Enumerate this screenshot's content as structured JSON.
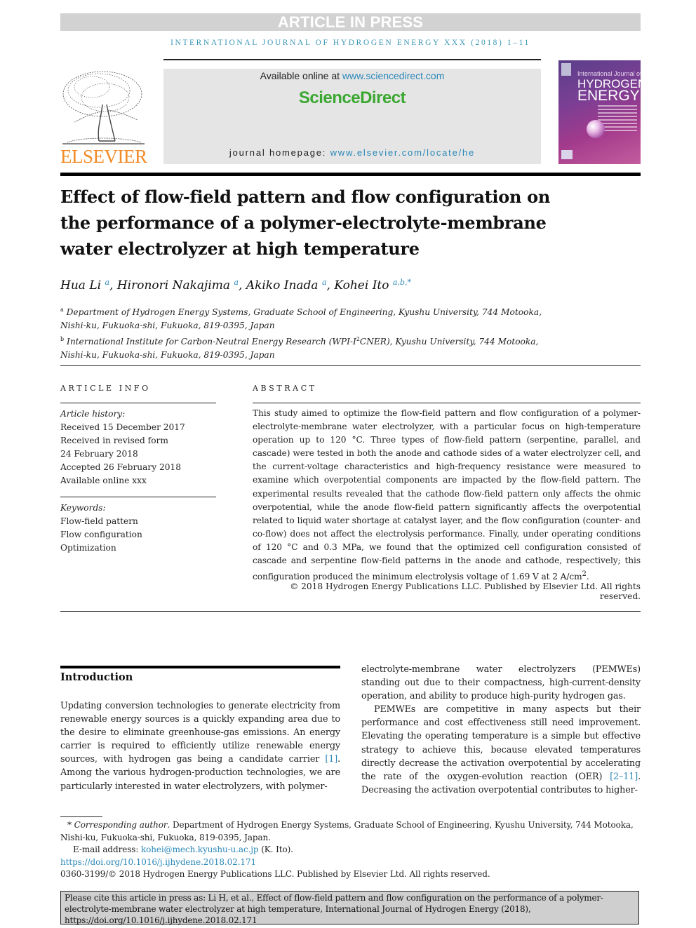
{
  "banner": {
    "article_in_press": "ARTICLE IN PRESS"
  },
  "journal_line": "INTERNATIONAL JOURNAL OF HYDROGEN ENERGY XXX (2018) 1–11",
  "header": {
    "publisher_logo_text": "ELSEVIER",
    "available_online_prefix": "Available online at ",
    "available_online_link": "www.sciencedirect.com",
    "sciencedirect_title": "ScienceDirect",
    "homepage_prefix": "journal homepage: ",
    "homepage_link": "www.elsevier.com/locate/he",
    "cover": {
      "subtitle": "International Journal of",
      "title_line1": "HYDROGEN",
      "title_line2": "ENERGY"
    },
    "colors": {
      "elsevier_orange": "#f28c28",
      "sciencedirect_green": "#3aa830",
      "link_blue": "#2a88b8",
      "cover_purple": "#7a3f94"
    }
  },
  "article": {
    "title": "Effect of flow-field pattern and flow configuration on the performance of a polymer-electrolyte-membrane water electrolyzer at high temperature",
    "authors": [
      {
        "name": "Hua Li",
        "sup": "a"
      },
      {
        "name": "Hironori Nakajima",
        "sup": "a"
      },
      {
        "name": "Akiko Inada",
        "sup": "a"
      },
      {
        "name": "Kohei Ito",
        "sup": "a,b,*"
      }
    ],
    "affiliations": [
      {
        "sup": "a",
        "text": "Department of Hydrogen Energy Systems, Graduate School of Engineering, Kyushu University, 744 Motooka, Nishi-ku, Fukuoka-shi, Fukuoka, 819-0395, Japan"
      },
      {
        "sup": "b",
        "text_before": "International Institute for Carbon-Neutral Energy Research (WPI-I",
        "text_sup": "2",
        "text_after": "CNER), Kyushu University, 744 Motooka, Nishi-ku, Fukuoka-shi, Fukuoka, 819-0395, Japan"
      }
    ]
  },
  "article_info": {
    "heading": "ARTICLE INFO",
    "history_label": "Article history:",
    "history": [
      "Received 15 December 2017",
      "Received in revised form",
      "24 February 2018",
      "Accepted 26 February 2018",
      "Available online xxx"
    ],
    "keywords_label": "Keywords:",
    "keywords": [
      "Flow-field pattern",
      "Flow configuration",
      "Optimization"
    ]
  },
  "abstract": {
    "heading": "ABSTRACT",
    "text": "This study aimed to optimize the flow-field pattern and flow configuration of a polymer-electrolyte-membrane water electrolyzer, with a particular focus on high-temperature operation up to 120 °C. Three types of flow-field pattern (serpentine, parallel, and cascade) were tested in both the anode and cathode sides of a water electrolyzer cell, and the current-voltage characteristics and high-frequency resistance were measured to examine which overpotential components are impacted by the flow-field pattern. The experimental results revealed that the cathode flow-field pattern only affects the ohmic overpotential, while the anode flow-field pattern significantly affects the overpotential related to liquid water shortage at catalyst layer, and the flow configuration (counter- and co-flow) does not affect the electrolysis performance. Finally, under operating conditions of 120 °C and 0.3 MPa, we found that the optimized cell configuration consisted of cascade and serpentine flow-field patterns in the anode and cathode, respectively; this configuration produced the minimum electrolysis voltage of 1.69 V at 2 A/cm",
    "text_sup": "2",
    "text_end": ".",
    "copyright": "© 2018 Hydrogen Energy Publications LLC. Published by Elsevier Ltd. All rights reserved."
  },
  "body": {
    "intro_heading": "Introduction",
    "left_col_before_ref": "Updating conversion technologies to generate electricity from renewable energy sources is a quickly expanding area due to the desire to eliminate greenhouse-gas emissions. An energy carrier is required to efficiently utilize renewable energy sources, with hydrogen gas being a candidate carrier ",
    "left_col_ref": "[1]",
    "left_col_after_ref": ". Among the various hydrogen-production technologies, we are particularly interested in water electrolyzers, with polymer-",
    "right_col_p1": "electrolyte-membrane water electrolyzers (PEMWEs) standing out due to their compactness, high-current-density operation, and ability to produce high-purity hydrogen gas.",
    "right_col_p2_before_ref": "PEMWEs are competitive in many aspects but their performance and cost effectiveness still need improvement. Elevating the operating temperature is a simple but effective strategy to achieve this, because elevated temperatures directly decrease the activation overpotential by accelerating the rate of the oxygen-evolution reaction (OER) ",
    "right_col_p2_ref": "[2–11]",
    "right_col_p2_after_ref": ". Decreasing the activation overpotential contributes to higher-"
  },
  "footnotes": {
    "corresponding_label": "* Corresponding author",
    "corresponding_text": ". Department of Hydrogen Energy Systems, Graduate School of Engineering, Kyushu University, 744 Motooka, Nishi-ku, Fukuoka-shi, Fukuoka, 819-0395, Japan.",
    "email_label": "E-mail address: ",
    "email": "kohei@mech.kyushu-u.ac.jp",
    "email_suffix": " (K. Ito).",
    "doi": "https://doi.org/10.1016/j.ijhydene.2018.02.171",
    "issn_copyright": "0360-3199/© 2018 Hydrogen Energy Publications LLC. Published by Elsevier Ltd. All rights reserved."
  },
  "citation_box": "Please cite this article in press as: Li H, et al., Effect of flow-field pattern and flow configuration on the performance of a polymer-electrolyte-membrane water electrolyzer at high temperature, International Journal of Hydrogen Energy (2018), https://doi.org/10.1016/j.ijhydene.2018.02.171"
}
